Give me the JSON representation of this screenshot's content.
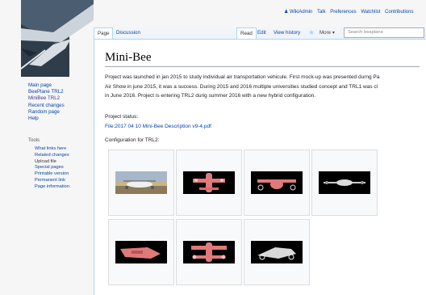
{
  "header": {
    "user": "WikiAdmin",
    "links": [
      "Talk",
      "Preferences",
      "Watchlist",
      "Contributions"
    ]
  },
  "tabs": {
    "page": "Page",
    "discussion": "Discussion",
    "read": "Read",
    "edit": "Edit",
    "history": "View history",
    "more": "More",
    "search_placeholder": "Search beaplane"
  },
  "sidebar": {
    "nav": [
      "Main page",
      "BeePlane TRL2",
      "MiniBee TRL2",
      "Recent changes",
      "Random page",
      "Help"
    ],
    "tools_heading": "Tools",
    "tools": [
      "What links here",
      "Related changes",
      "Upload file",
      "Special pages",
      "Printable version",
      "Permanent link",
      "Page information"
    ]
  },
  "article": {
    "title": "Mini-Bee",
    "lines": [
      "Project was launched in jan 2015 to study individual air transportation vehicule. First mock-up was presented durng Pa",
      "Air Show in june 2015, it was a success. During 2015 and 2016 multiple universities studied concept and TRL1 was cl",
      "in June 2016. Project is entering TRL2 durig summer 2016 with a new hybrid configuration."
    ],
    "status_label": "Project status:",
    "pdf_link": "File:2017 04 10 Mini-Bee Description v9-4.pdf",
    "config_label": "Configuration for TRL2:"
  },
  "colors": {
    "link": "#0645ad",
    "border": "#a7d7f9",
    "aircraft_pink": "#e07a7a"
  }
}
